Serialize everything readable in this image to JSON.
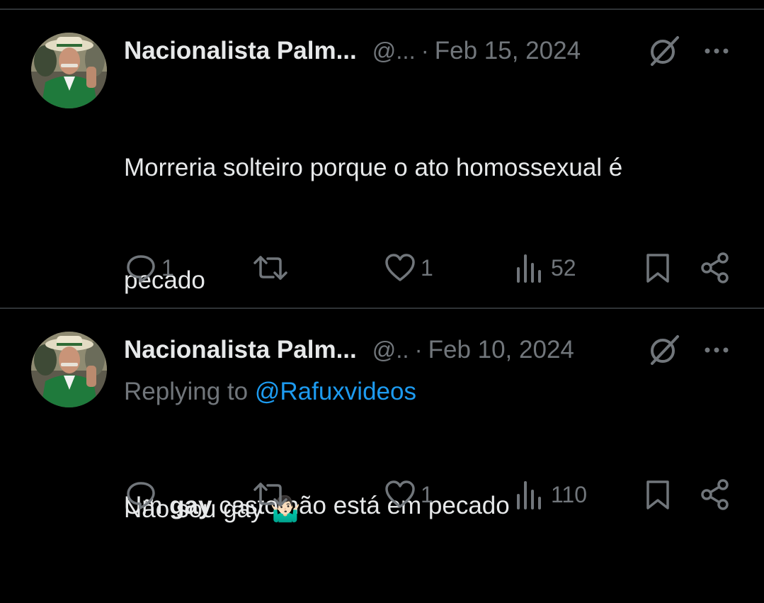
{
  "tweets": [
    {
      "author_name": "Nacionalista Palm...",
      "handle": "@...",
      "date": "Feb 15, 2024",
      "text_line1": "Morreria solteiro porque o ato homossexual é",
      "text_line2": "pecado",
      "text_line4_pre": "Um ",
      "text_line4_bold": "gay",
      "text_line4_post": " casto não está em pecado",
      "replies": "1",
      "retweets": "",
      "likes": "1",
      "views": "52"
    },
    {
      "author_name": "Nacionalista Palm...",
      "handle": "@..",
      "date": "Feb 10, 2024",
      "replying_prefix": "Replying to ",
      "replying_to": "@Rafuxvideos",
      "text": "Não sou gay 🤷🏻‍♂️",
      "replies": "",
      "retweets": "",
      "likes": "1",
      "views": "110"
    }
  ],
  "icons": {
    "reply": "reply-icon",
    "retweet": "retweet-icon",
    "like": "heart-icon",
    "views": "views-icon",
    "bookmark": "bookmark-icon",
    "share": "share-icon",
    "grok": "grok-icon",
    "more": "more-icon"
  },
  "colors": {
    "background": "#000000",
    "text": "#e7e9ea",
    "muted": "#71767b",
    "link": "#1d9bf0",
    "divider": "#2f3336"
  }
}
